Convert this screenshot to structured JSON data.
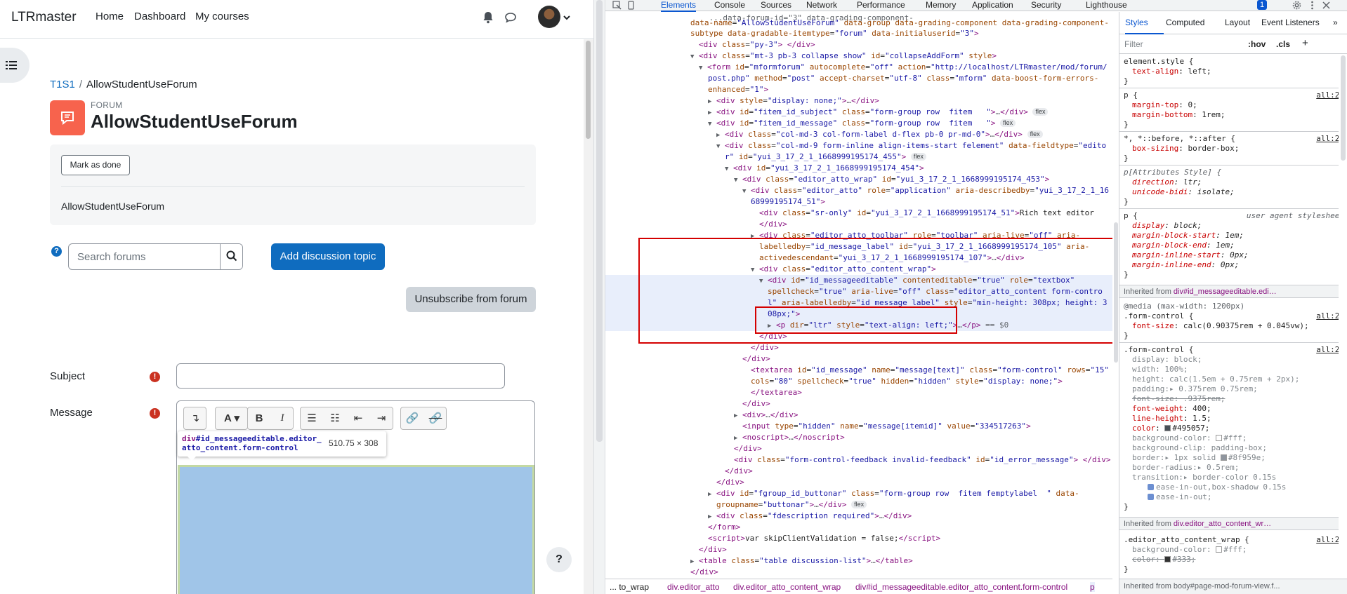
{
  "colors": {
    "brand_blue": "#0f6cbf",
    "forum_orange": "#f7634d",
    "required_red": "#ca3120",
    "devtools_accent": "#0b57d0",
    "highlight_box": "#d40000",
    "editable_highlight": "#a0c5e8"
  },
  "navbar": {
    "brand": "LTRmaster",
    "links": [
      "Home",
      "Dashboard",
      "My courses"
    ],
    "icons": [
      "bell-icon",
      "chat-icon",
      "avatar",
      "chevron-down-icon"
    ]
  },
  "breadcrumb": {
    "course": "T1S1",
    "current": "AllowStudentUseForum"
  },
  "header": {
    "label": "FORUM",
    "title": "AllowStudentUseForum"
  },
  "card": {
    "mark_done": "Mark as done",
    "description": "AllowStudentUseForum"
  },
  "search": {
    "help": "?",
    "placeholder": "Search forums"
  },
  "buttons": {
    "add_topic": "Add discussion topic",
    "unsubscribe": "Unsubscribe from forum",
    "help": "?"
  },
  "form": {
    "subject_label": "Subject",
    "message_label": "Message",
    "required_icon": "!"
  },
  "editor_toolbar": [
    "collapse-icon",
    "font-style-icon",
    "bold-icon",
    "italic-icon",
    "unordered-list-icon",
    "ordered-list-icon",
    "outdent-icon",
    "indent-icon",
    "link-icon",
    "unlink-icon"
  ],
  "inspect_tooltip": {
    "tag": "div",
    "selector": "#id_messageeditable.editor_",
    "selector2": "atto_content.form-control",
    "size": "510.75 × 308"
  },
  "devtools": {
    "tabs": [
      "Elements",
      "Console",
      "Sources",
      "Network",
      "Performance",
      "Memory",
      "Application",
      "Security",
      "Lighthouse"
    ],
    "active_tab": "Elements",
    "issues_badge": "1",
    "styles_tabs": [
      "Styles",
      "Computed",
      "Layout",
      "Event Listeners"
    ],
    "filter_placeholder": "Filter",
    "hov": ":hov",
    "cls": ".cls",
    "breadcrumbs": [
      "... to_wrap",
      "div.editor_atto",
      "div.editor_atto_content_wrap",
      "div#id_messageeditable.editor_atto_content.form-control",
      "p"
    ],
    "inherited_bottom": "Inherited from body#page-mod-forum-view.f..."
  }
}
